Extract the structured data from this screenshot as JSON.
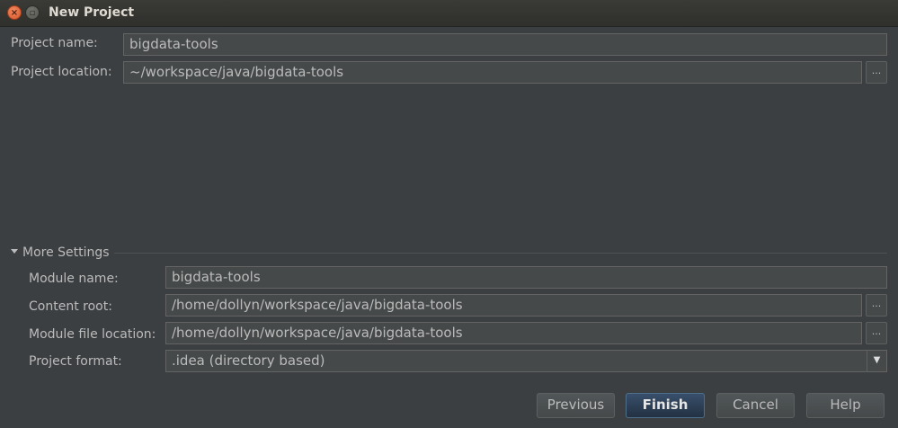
{
  "window": {
    "title": "New Project",
    "close_glyph": "×",
    "maximize_glyph": "▫"
  },
  "project": {
    "name_label": "Project name:",
    "name_value": "bigdata-tools",
    "location_label": "Project location:",
    "location_value": "~/workspace/java/bigdata-tools",
    "browse_glyph": "..."
  },
  "more_settings": {
    "title": "More Settings",
    "module_name_label": "Module name:",
    "module_name_value": "bigdata-tools",
    "content_root_label": "Content root:",
    "content_root_value": "/home/dollyn/workspace/java/bigdata-tools",
    "module_file_label": "Module file location:",
    "module_file_value": "/home/dollyn/workspace/java/bigdata-tools",
    "project_format_label": "Project format:",
    "project_format_value": ".idea (directory based)",
    "dropdown_glyph": "▼",
    "browse_glyph": "..."
  },
  "buttons": {
    "previous": "Previous",
    "finish": "Finish",
    "cancel": "Cancel",
    "help": "Help"
  },
  "colors": {
    "background": "#3c3f41",
    "field_background": "#45494a",
    "default_button": "#2b3e55"
  }
}
